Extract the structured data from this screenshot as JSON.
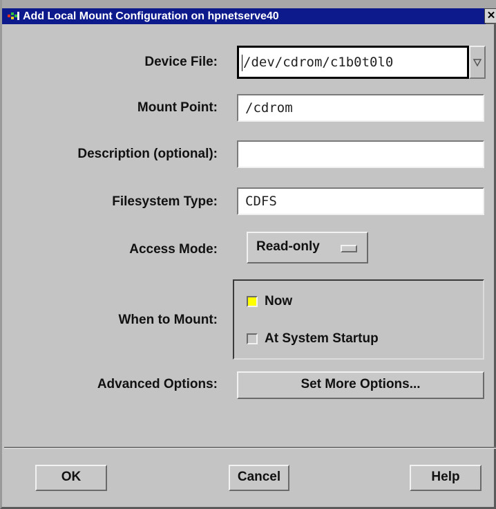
{
  "window": {
    "title": "Add Local Mount Configuration on hpnetserve40",
    "close_glyph": "✕"
  },
  "form": {
    "device_file": {
      "label": "Device File:",
      "value": "/dev/cdrom/c1b0t0l0"
    },
    "mount_point": {
      "label": "Mount Point:",
      "value": "/cdrom"
    },
    "description": {
      "label": "Description (optional):",
      "value": ""
    },
    "fs_type": {
      "label": "Filesystem Type:",
      "value": "CDFS"
    },
    "access_mode": {
      "label": "Access Mode:",
      "selected": "Read-only"
    },
    "when_to_mount": {
      "label": "When to Mount:",
      "options": [
        {
          "label": "Now",
          "selected": true
        },
        {
          "label": "At System Startup",
          "selected": false
        }
      ]
    },
    "advanced": {
      "label": "Advanced Options:",
      "button": "Set More Options..."
    }
  },
  "footer": {
    "ok": "OK",
    "cancel": "Cancel",
    "help": "Help"
  },
  "colors": {
    "titlebar": "#0c1a8c",
    "selected_indicator": "#ffff00",
    "unselected_indicator": "#c8c8c8",
    "background": "#c4c4c4"
  }
}
